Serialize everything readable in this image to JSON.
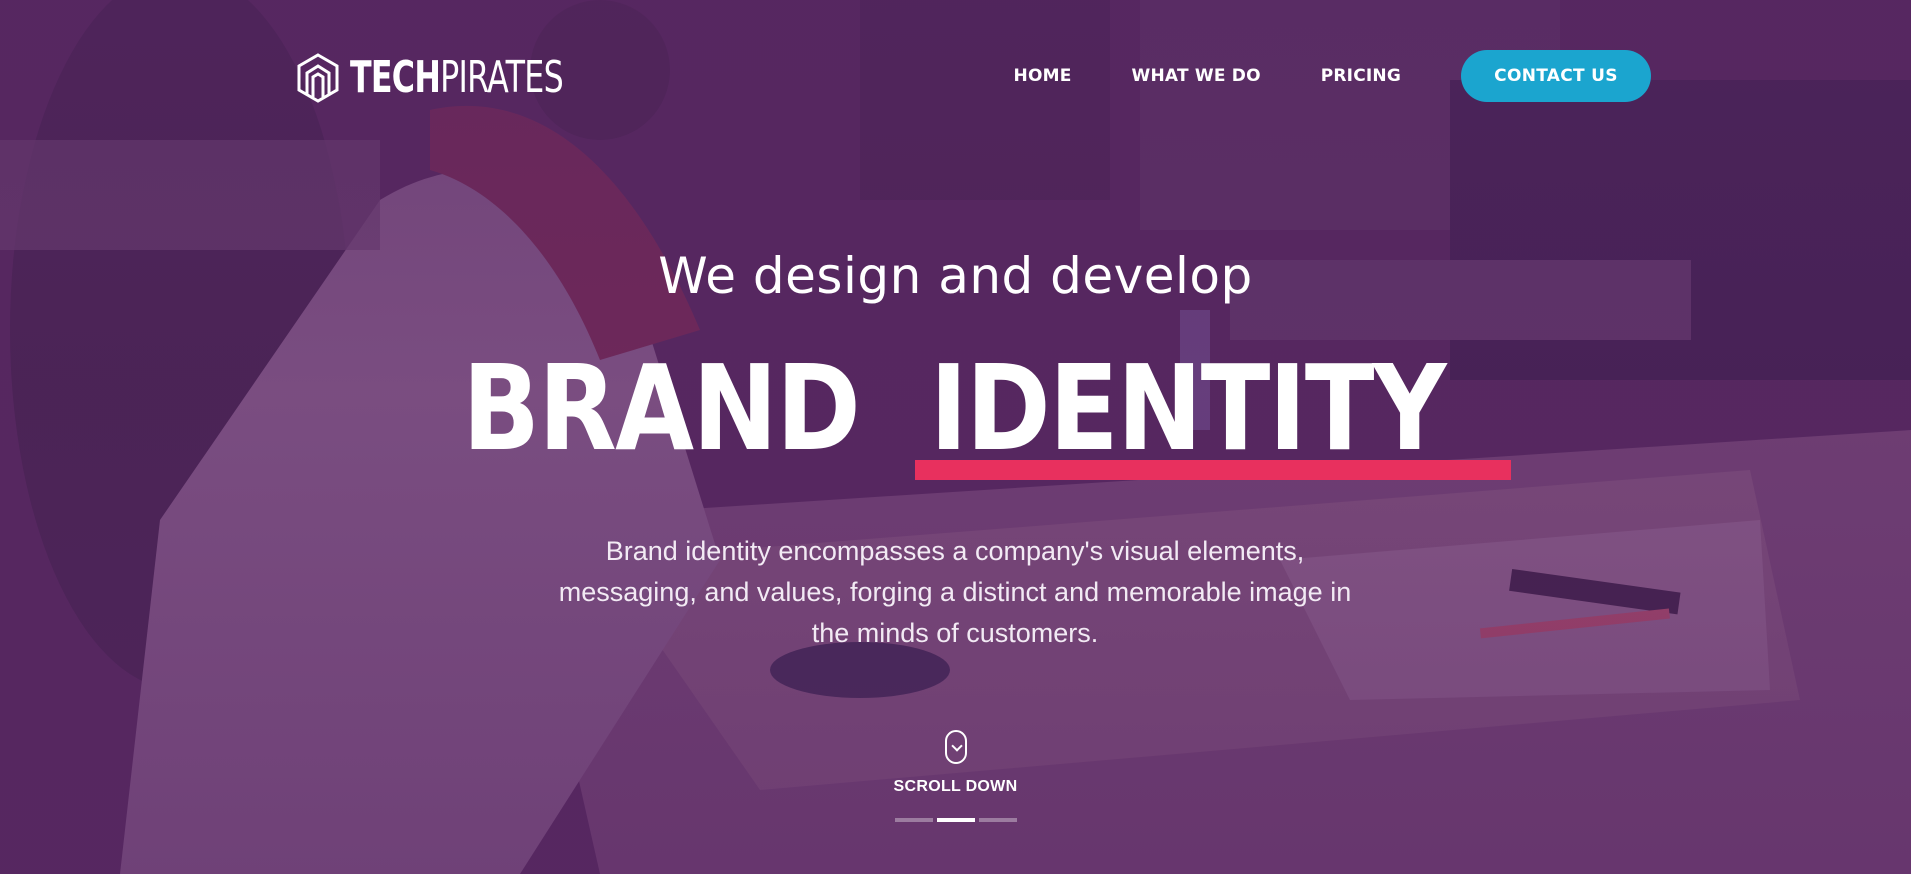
{
  "logo": {
    "part1": "TECH",
    "part2": "PIRATES",
    "icon": "hexagon-logo-icon"
  },
  "nav": {
    "items": [
      {
        "label": "HOME"
      },
      {
        "label": "WHAT WE DO"
      },
      {
        "label": "PRICING"
      }
    ],
    "cta_label": "CONTACT US"
  },
  "hero": {
    "tagline": "We design and develop",
    "headline_word1": "BRAND",
    "headline_word2": "IDENTITY",
    "description": "Brand identity encompasses a company's visual elements, messaging, and values, forging a distinct and memorable image in the minds of customers.",
    "scroll_label": "SCROLL DOWN",
    "scroll_icon": "mouse-scroll-icon",
    "slider": {
      "count": 3,
      "active_index": 1
    }
  },
  "colors": {
    "overlay": "#562662",
    "accent_underline": "#e8305e",
    "cta_button": "#1ba5cf"
  }
}
